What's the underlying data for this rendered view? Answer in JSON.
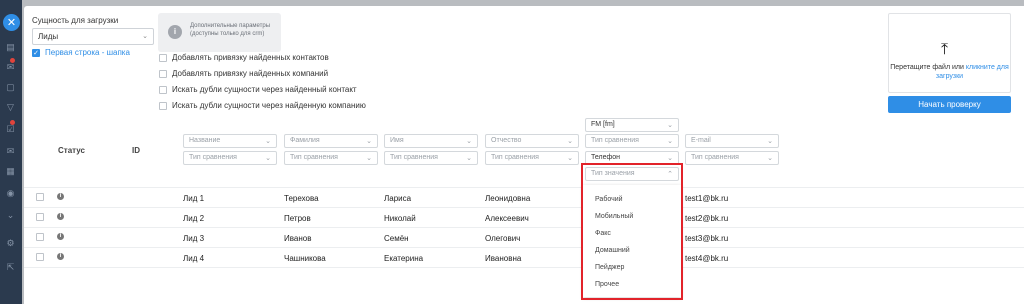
{
  "upload": {
    "label": "Сущность для загрузки",
    "entity_value": "Лиды",
    "header_row_label": "Первая строка - шапка",
    "header_row_checked": true
  },
  "info": {
    "text": "Дополнительные параметры (доступны только для crm)"
  },
  "options": [
    {
      "label": "Добавлять привязку найденных контактов",
      "checked": false
    },
    {
      "label": "Добавлять привязку найденных компаний",
      "checked": false
    },
    {
      "label": "Искать дубли сущности через найденный контакт",
      "checked": false
    },
    {
      "label": "Искать дубли сущности через найденную компанию",
      "checked": false
    }
  ],
  "dropzone": {
    "text": "Перетащите файл или",
    "link": "кликните для загрузки"
  },
  "start_button": "Начать проверку",
  "table": {
    "headers": {
      "status": "Статус",
      "id": "ID"
    },
    "field_selects": [
      {
        "field": "Название",
        "compare": "Тип сравнения"
      },
      {
        "field": "Фамилия",
        "compare": "Тип сравнения"
      },
      {
        "field": "Имя",
        "compare": "Тип сравнения"
      },
      {
        "field": "Отчество",
        "compare": "Тип сравнения"
      },
      {
        "field": "FM [fm]",
        "compare": "Тип сравнения",
        "subfield": "Телефон",
        "value_type": "Тип значения"
      },
      {
        "field": "E-mail",
        "compare": "Тип сравнения"
      }
    ],
    "rows": [
      {
        "name": "Лид 1",
        "last": "Терехова",
        "first": "Лариса",
        "middle": "Леонидовна",
        "email": "test1@bk.ru"
      },
      {
        "name": "Лид 2",
        "last": "Петров",
        "first": "Николай",
        "middle": "Алексеевич",
        "email": "test2@bk.ru"
      },
      {
        "name": "Лид 3",
        "last": "Иванов",
        "first": "Семён",
        "middle": "Олегович",
        "email": "test3@bk.ru"
      },
      {
        "name": "Лид 4",
        "last": "Чашникова",
        "first": "Екатерина",
        "middle": "Ивановна",
        "email": "test4@bk.ru"
      }
    ]
  },
  "value_type_menu": [
    "Рабочий",
    "Мобильный",
    "Факс",
    "Домашний",
    "Пейджер",
    "Прочее"
  ],
  "colors": {
    "accent": "#2f8ee6",
    "highlight": "#e2232a",
    "rail": "#2b3a4e"
  }
}
